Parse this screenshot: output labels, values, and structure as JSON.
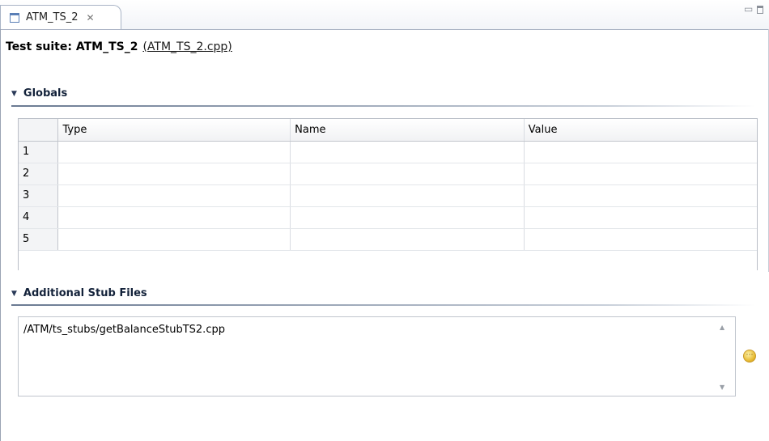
{
  "tab": {
    "label": "ATM_TS_2",
    "close_glyph": "✕"
  },
  "window_controls": {
    "minimize_glyph": "▭"
  },
  "header": {
    "prefix": "Test suite: ATM_TS_2",
    "file_link": "(ATM_TS_2.cpp)"
  },
  "globals": {
    "title": "Globals",
    "columns": [
      "Type",
      "Name",
      "Value"
    ],
    "rows": [
      "1",
      "2",
      "3",
      "4",
      "5"
    ]
  },
  "stubs": {
    "title": "Additional Stub Files",
    "items": [
      "/ATM/ts_stubs/getBalanceStubTS2.cpp"
    ],
    "scroll_up": "▲",
    "scroll_down": "▼",
    "add_glyph": "⋯"
  },
  "colors": {
    "section_text": "#13223a",
    "tab_border": "#a9b4c6",
    "add_button": "#e6b930"
  }
}
